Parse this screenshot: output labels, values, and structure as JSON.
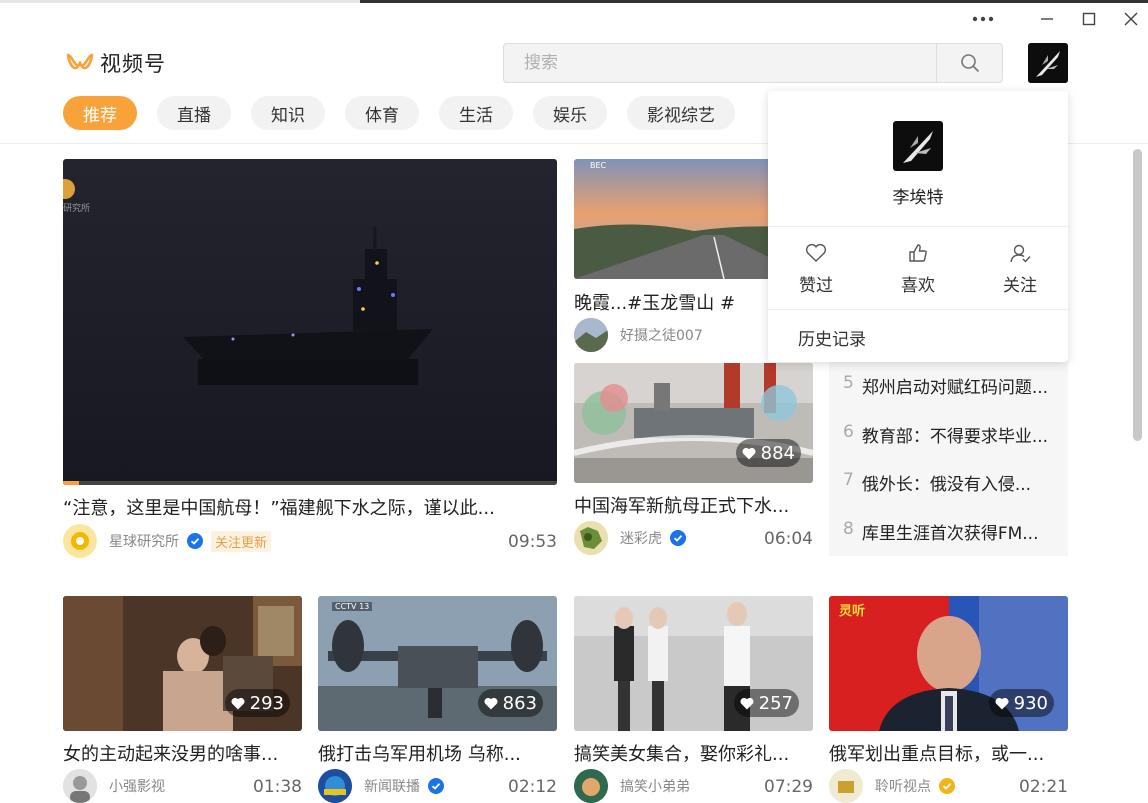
{
  "app": {
    "name": "视频号"
  },
  "search": {
    "placeholder": "搜索"
  },
  "tabs": [
    {
      "label": "推荐",
      "active": true
    },
    {
      "label": "直播"
    },
    {
      "label": "知识"
    },
    {
      "label": "体育"
    },
    {
      "label": "生活"
    },
    {
      "label": "娱乐"
    },
    {
      "label": "影视综艺"
    }
  ],
  "featured": {
    "title": "“注意，这里是中国航母！”福建舰下水之际，谨以此...",
    "author": "星球研究所",
    "follow_tag": "关注更新",
    "duration": "09:53",
    "watermark": "研究所"
  },
  "cards": {
    "sunset": {
      "title": "晚霞...#玉龙雪山 #",
      "author": "好摄之徒007",
      "badge": "BEC"
    },
    "navy": {
      "title": "中国海军新航母正式下水...",
      "author": "迷彩虎",
      "likes": "884",
      "duration": "06:04"
    },
    "drama": {
      "title": "女的主动起来没男的啥事...",
      "author": "小强影视",
      "likes": "293",
      "duration": "01:38"
    },
    "osprey": {
      "title": "俄打击乌军用机场 乌称...",
      "author": "新闻联播",
      "likes": "863",
      "duration": "02:12",
      "badge": "CCTV 13"
    },
    "girls": {
      "title": "搞笑美女集合，娶你彩礼...",
      "author": "搞笑小弟弟",
      "likes": "257",
      "duration": "07:29"
    },
    "medvedev": {
      "title": "俄军划出重点目标，或一...",
      "author": "聆听视点",
      "likes": "930",
      "duration": "02:21",
      "badge": "灵听"
    }
  },
  "trending": [
    {
      "num": "5",
      "text": "郑州启动对赋红码问题..."
    },
    {
      "num": "6",
      "text": "教育部：不得要求毕业..."
    },
    {
      "num": "7",
      "text": "俄外长：俄没有入侵..."
    },
    {
      "num": "8",
      "text": "库里生涯首次获得FM..."
    }
  ],
  "popup": {
    "username": "李埃特",
    "actions": [
      "赞过",
      "喜欢",
      "关注"
    ],
    "history": "历史记录"
  },
  "colors": {
    "accent": "#f7a33a",
    "verified": "#1a73e8"
  }
}
